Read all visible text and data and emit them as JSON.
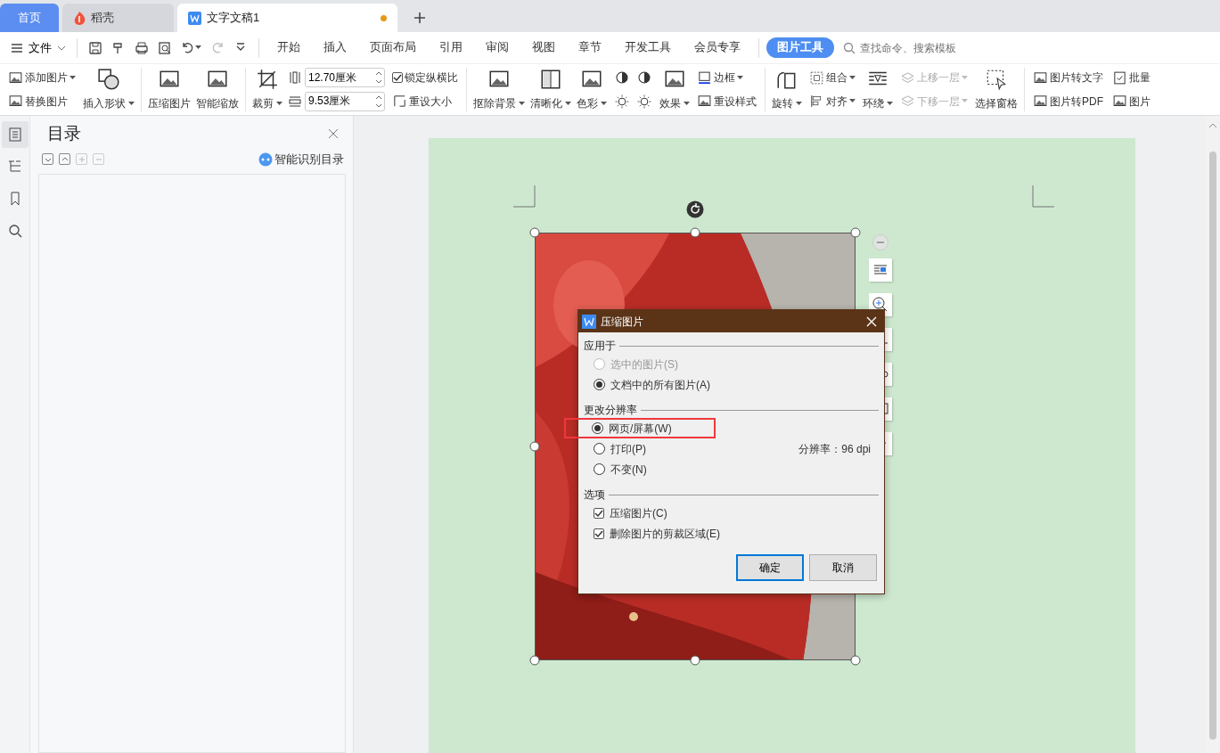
{
  "tabs": [
    {
      "label": "首页",
      "kind": "home",
      "selected": false
    },
    {
      "label": "稻壳",
      "kind": "docer",
      "selected": false
    },
    {
      "label": "文字文稿1",
      "kind": "doc",
      "selected": true,
      "unsaved": true
    }
  ],
  "menu": {
    "file": "文件",
    "quick_access": [
      {
        "disabled": false
      },
      {
        "disabled": false
      },
      {
        "disabled": false
      },
      {
        "disabled": false
      },
      {
        "disabled": false
      },
      {
        "disabled": true
      },
      {
        "disabled": false
      }
    ],
    "items": [
      {
        "label": "开始",
        "selected": false
      },
      {
        "label": "插入",
        "selected": false
      },
      {
        "label": "页面布局",
        "selected": false
      },
      {
        "label": "引用",
        "selected": false
      },
      {
        "label": "审阅",
        "selected": false
      },
      {
        "label": "视图",
        "selected": false
      },
      {
        "label": "章节",
        "selected": false
      },
      {
        "label": "开发工具",
        "selected": false
      },
      {
        "label": "会员专享",
        "selected": false
      },
      {
        "label": "图片工具",
        "selected": true
      }
    ],
    "search_placeholder": "查找命令、搜索模板"
  },
  "ribbon": [
    {
      "kind": "stack",
      "items": [
        {
          "label": "添加图片",
          "dropdown": true
        },
        {
          "label": "替换图片",
          "dropdown": false
        }
      ]
    },
    {
      "kind": "large",
      "label": "插入形状",
      "dropdown": true
    },
    {
      "kind": "sep"
    },
    {
      "kind": "large",
      "label": "压缩图片",
      "dropdown": false
    },
    {
      "kind": "large",
      "label": "智能缩放",
      "dropdown": false
    },
    {
      "kind": "sep"
    },
    {
      "kind": "large",
      "label": "裁剪",
      "dropdown": true
    },
    {
      "kind": "size",
      "fields": [
        {
          "value": "12.70厘米"
        },
        {
          "value": "9.53厘米"
        }
      ]
    },
    {
      "kind": "stack",
      "items": [
        {
          "label": "锁定纵横比",
          "checkbox": true,
          "checked": true
        },
        {
          "label": "重设大小",
          "dropdown": false
        }
      ]
    },
    {
      "kind": "sep"
    },
    {
      "kind": "large",
      "label": "抠除背景",
      "dropdown": true
    },
    {
      "kind": "large",
      "label": "清晰化",
      "dropdown": true
    },
    {
      "kind": "large",
      "label": "色彩",
      "dropdown": true
    },
    {
      "kind": "icons"
    },
    {
      "kind": "large",
      "label": "效果",
      "dropdown": true
    },
    {
      "kind": "stack",
      "items": [
        {
          "label": "边框",
          "dropdown": true
        },
        {
          "label": "重设样式",
          "dropdown": false
        }
      ]
    },
    {
      "kind": "sep"
    },
    {
      "kind": "large",
      "label": "旋转",
      "dropdown": true
    },
    {
      "kind": "stack",
      "items": [
        {
          "label": "组合",
          "dropdown": true
        },
        {
          "label": "对齐",
          "dropdown": true
        }
      ]
    },
    {
      "kind": "large",
      "label": "环绕",
      "dropdown": true
    },
    {
      "kind": "stack",
      "items": [
        {
          "label": "上移一层",
          "dropdown": true,
          "disabled": true
        },
        {
          "label": "下移一层",
          "dropdown": true,
          "disabled": true
        }
      ]
    },
    {
      "kind": "large",
      "label": "选择窗格",
      "dropdown": false
    },
    {
      "kind": "sep"
    },
    {
      "kind": "stack",
      "items": [
        {
          "label": "图片转文字",
          "dropdown": false
        },
        {
          "label": "图片转PDF",
          "dropdown": false
        }
      ]
    },
    {
      "kind": "stack",
      "items": [
        {
          "label": "批量",
          "dropdown": false
        },
        {
          "label": "图片",
          "dropdown": false
        }
      ]
    }
  ],
  "sidebar": {
    "rail": [
      {
        "selected": true
      },
      {
        "selected": false
      },
      {
        "selected": false
      },
      {
        "selected": false
      }
    ],
    "title": "目录",
    "tools": [
      {
        "disabled": false
      },
      {
        "disabled": false
      },
      {
        "disabled": true
      },
      {
        "disabled": true
      }
    ],
    "smart_toc": "智能识别目录"
  },
  "dialog": {
    "title": "压缩图片",
    "sections": [
      {
        "title": "应用于",
        "kind": "radios",
        "options": [
          {
            "label": "选中的图片(S)",
            "selected": false,
            "disabled": true
          },
          {
            "label": "文档中的所有图片(A)",
            "selected": true
          }
        ]
      },
      {
        "title": "更改分辨率",
        "kind": "radios",
        "options": [
          {
            "label": "网页/屏幕(W)",
            "selected": true,
            "highlighted": true
          },
          {
            "label": "打印(P)",
            "selected": false
          },
          {
            "label": "不变(N)",
            "selected": false
          }
        ],
        "note": "分辨率：96 dpi"
      },
      {
        "title": "选项",
        "kind": "checks",
        "options": [
          {
            "label": "压缩图片(C)",
            "checked": true
          },
          {
            "label": "删除图片的剪裁区域(E)",
            "checked": true
          }
        ]
      }
    ],
    "buttons": [
      {
        "label": "确定",
        "default": true
      },
      {
        "label": "取消",
        "default": false
      }
    ]
  }
}
